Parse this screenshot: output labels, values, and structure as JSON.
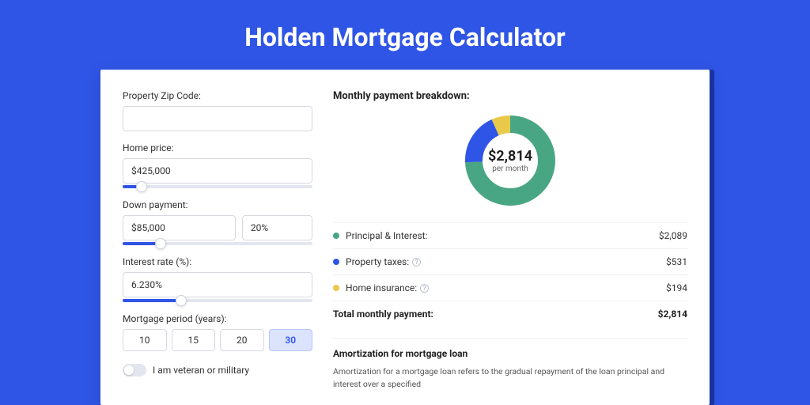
{
  "title": "Holden Mortgage Calculator",
  "form": {
    "zip_label": "Property Zip Code:",
    "zip_value": "",
    "price_label": "Home price:",
    "price_value": "$425,000",
    "price_slider_pct": 10,
    "down_label": "Down payment:",
    "down_value": "$85,000",
    "down_pct": "20%",
    "down_slider_pct": 20,
    "rate_label": "Interest rate (%):",
    "rate_value": "6.230%",
    "rate_slider_pct": 31,
    "period_label": "Mortgage period (years):",
    "periods": [
      "10",
      "15",
      "20",
      "30"
    ],
    "period_selected": "30",
    "veteran_label": "I am veteran or military"
  },
  "breakdown": {
    "title": "Monthly payment breakdown:",
    "center_amount": "$2,814",
    "center_sub": "per month",
    "items": [
      {
        "color": "g",
        "label": "Principal & Interest:",
        "value": "$2,089",
        "info": false
      },
      {
        "color": "b",
        "label": "Property taxes:",
        "value": "$531",
        "info": true
      },
      {
        "color": "y",
        "label": "Home insurance:",
        "value": "$194",
        "info": true
      }
    ],
    "total_label": "Total monthly payment:",
    "total_value": "$2,814"
  },
  "amort": {
    "title": "Amortization for mortgage loan",
    "text": "Amortization for a mortgage loan refers to the gradual repayment of the loan principal and interest over a specified"
  },
  "chart_data": {
    "type": "pie",
    "title": "Monthly payment breakdown",
    "series": [
      {
        "name": "Principal & Interest",
        "value": 2089,
        "color": "#49a684"
      },
      {
        "name": "Property taxes",
        "value": 531,
        "color": "#2f55e6"
      },
      {
        "name": "Home insurance",
        "value": 194,
        "color": "#e8c94a"
      }
    ],
    "total": 2814,
    "center_label": "$2,814 per month"
  }
}
